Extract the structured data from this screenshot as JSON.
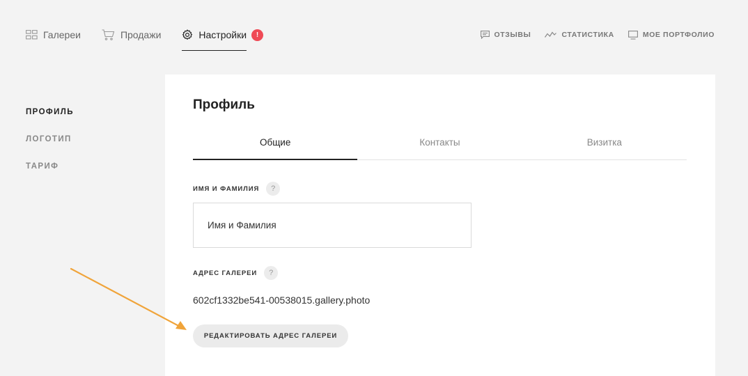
{
  "topnav": {
    "items": [
      {
        "label": "Галереи",
        "icon": "grid-icon"
      },
      {
        "label": "Продажи",
        "icon": "cart-icon"
      },
      {
        "label": "Настройки",
        "icon": "gear-icon",
        "active": true,
        "badge": "!"
      }
    ],
    "links": [
      {
        "label": "ОТЗЫВЫ",
        "icon": "comment-icon"
      },
      {
        "label": "СТАТИСТИКА",
        "icon": "chart-line-icon"
      },
      {
        "label": "МОЕ ПОРТФОЛИО",
        "icon": "monitor-icon"
      }
    ]
  },
  "sidemenu": {
    "items": [
      {
        "label": "ПРОФИЛЬ",
        "active": true
      },
      {
        "label": "ЛОГОТИП"
      },
      {
        "label": "ТАРИФ"
      }
    ]
  },
  "profile": {
    "title": "Профиль",
    "tabs": [
      {
        "label": "Общие",
        "active": true
      },
      {
        "label": "Контакты"
      },
      {
        "label": "Визитка"
      }
    ],
    "name_field": {
      "label": "ИМЯ И ФАМИЛИЯ",
      "help": "?",
      "placeholder": "Имя и Фамилия",
      "value": ""
    },
    "gallery_field": {
      "label": "АДРЕС ГАЛЕРЕИ",
      "help": "?",
      "value": "602cf1332be541-00538015.gallery.photo"
    },
    "edit_button": "РЕДАКТИРОВАТЬ АДРЕС ГАЛЕРЕИ"
  },
  "colors": {
    "background": "#f3f3f3",
    "card": "#ffffff",
    "badge": "#ef4a56",
    "annotation_arrow": "#f0a43a"
  }
}
